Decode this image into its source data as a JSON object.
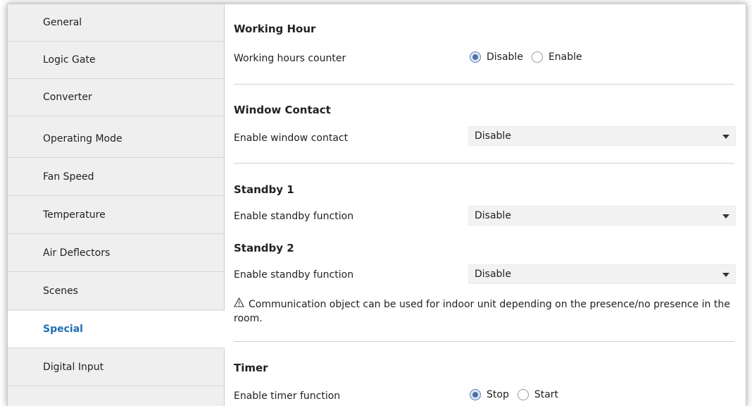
{
  "sidebar": {
    "items": [
      {
        "label": "General"
      },
      {
        "label": "Logic Gate"
      },
      {
        "label": "Converter"
      },
      {
        "label": "Operating Mode"
      },
      {
        "label": "Fan Speed"
      },
      {
        "label": "Temperature"
      },
      {
        "label": "Air Deflectors"
      },
      {
        "label": "Scenes"
      },
      {
        "label": "Special",
        "active": true
      },
      {
        "label": "Digital Input"
      }
    ]
  },
  "main": {
    "working_hour": {
      "title": "Working Hour",
      "counter_label": "Working hours counter",
      "options": [
        {
          "label": "Disable",
          "checked": true
        },
        {
          "label": "Enable",
          "checked": false
        }
      ]
    },
    "window_contact": {
      "title": "Window Contact",
      "label": "Enable window contact",
      "value": "Disable"
    },
    "standby1": {
      "title": "Standby 1",
      "label": "Enable standby function",
      "value": "Disable"
    },
    "standby2": {
      "title": "Standby 2",
      "label": "Enable standby function",
      "value": "Disable"
    },
    "note": {
      "icon": "warning-icon",
      "text": "Communication object can be used for indoor unit depending on the presence/no presence in the room."
    },
    "timer": {
      "title": "Timer",
      "label": "Enable timer function",
      "options": [
        {
          "label": "Stop",
          "checked": true
        },
        {
          "label": "Start",
          "checked": false
        }
      ]
    }
  }
}
